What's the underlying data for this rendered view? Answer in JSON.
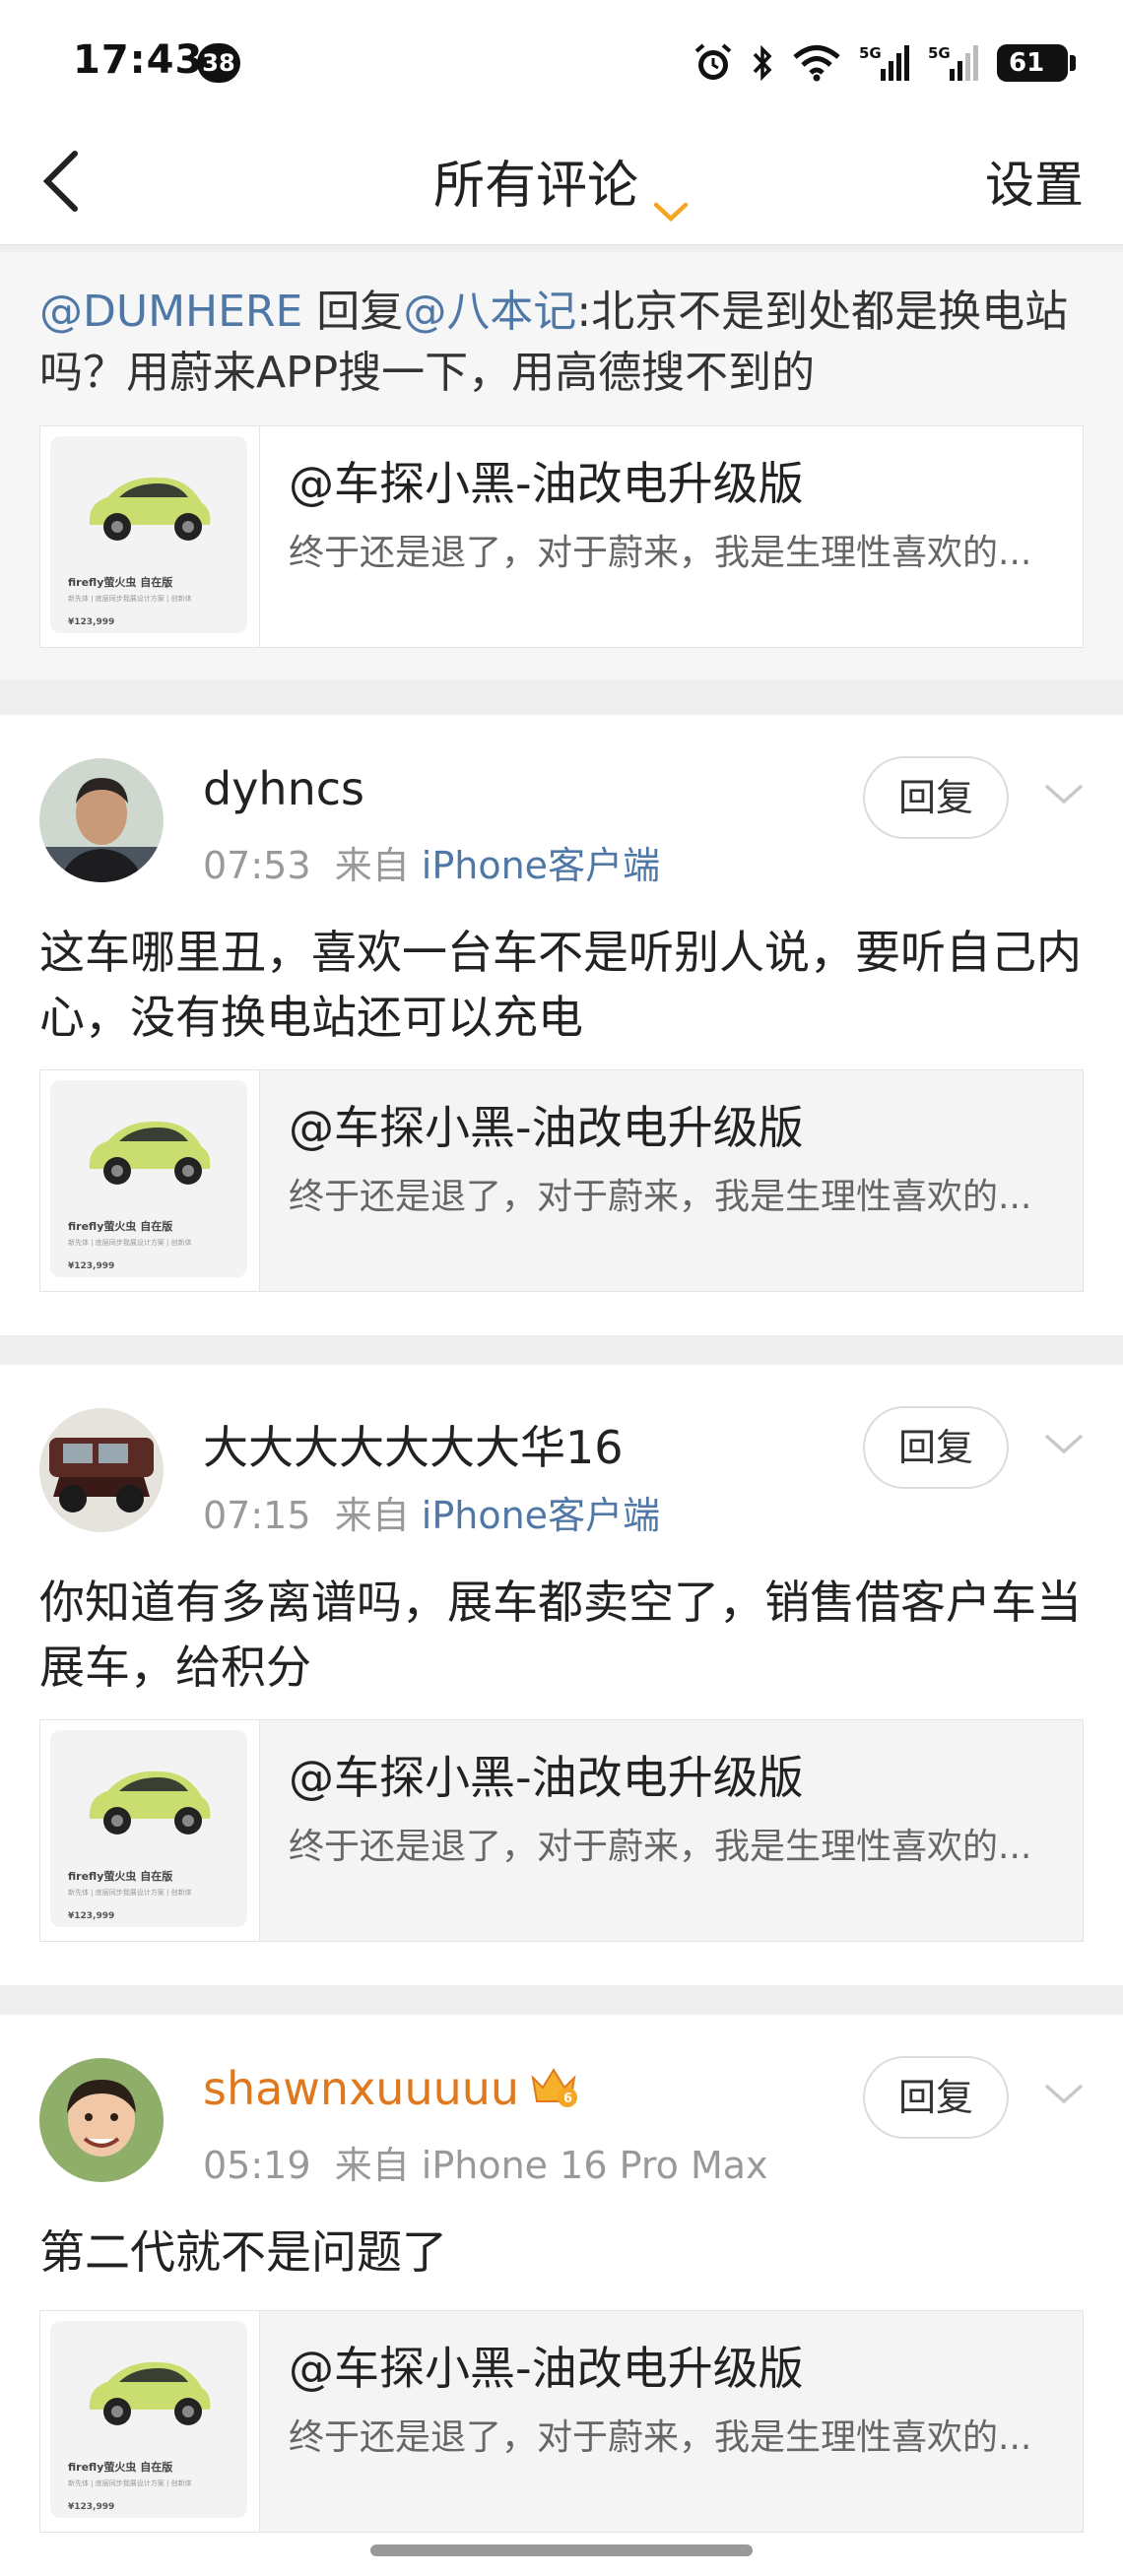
{
  "status_bar": {
    "time": "17:43",
    "badge": "38",
    "battery": "61",
    "signal1": "5G",
    "signal2": "5G"
  },
  "nav": {
    "title": "所有评论",
    "settings": "设置"
  },
  "reply": {
    "user": "@DUMHERE",
    "verb": " 回复",
    "target": "@八本记",
    "text": ":北京不是到处都是换电站吗？用蔚来APP搜一下，用高德搜不到的"
  },
  "card": {
    "title": "@车探小黑-油改电升级版",
    "desc": "终于还是退了，对于蔚来，我是生理性喜欢的...",
    "thumb_title": "firefly萤火虫 自在版",
    "thumb_sub": "新先体 | 底层同步我展设计方案 | 创新体",
    "thumb_price": "¥123,999"
  },
  "comments": [
    {
      "user": "dyhncs",
      "time": "07:53",
      "from": "来自",
      "source": "iPhone客户端",
      "reply": "回复",
      "text": "这车哪里丑，喜欢一台车不是听别人说，要听自己内心，没有换电站还可以充电",
      "vip": false
    },
    {
      "user": "大大大大大大大华16",
      "time": "07:15",
      "from": "来自",
      "source": "iPhone客户端",
      "reply": "回复",
      "text": "你知道有多离谱吗，展车都卖空了，销售借客户车当展车，给积分",
      "vip": false
    },
    {
      "user": "shawnxuuuuu",
      "time": "05:19",
      "from": "来自",
      "source": "iPhone 16 Pro Max",
      "reply": "回复",
      "text": "第二代就不是问题了",
      "vip": true
    }
  ],
  "colors": {
    "link": "#4f78a6",
    "vip_name": "#e0781e",
    "accent": "#f5a623"
  }
}
